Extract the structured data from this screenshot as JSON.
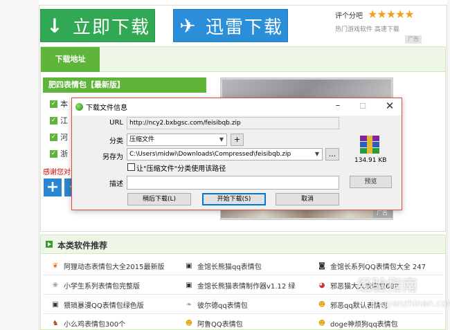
{
  "header": {
    "download_now": "立即下载",
    "xunlei_download": "迅雷下载",
    "rate_label": "评个分吧",
    "stars": "★★★★★",
    "sub_links": "热门游戏软件  高速下载",
    "ad": "广告"
  },
  "download_panel": {
    "tab": "下载地址",
    "package_title": "肥四表情包【最新版】",
    "rows": [
      "本",
      "江",
      "河",
      "浙"
    ],
    "thanks": "感谢您对",
    "ad": "广告"
  },
  "dialog": {
    "title": "下载文件信息",
    "url_label": "URL",
    "url_value": "http://ncy2.bxbgsc.com/feisibqb.zip",
    "category_label": "分类",
    "category_value": "压缩文件",
    "add_button": "+",
    "saveas_label": "另存为",
    "saveas_value": "C:\\Users\\midwi\\Downloads\\Compressed\\feisibqb.zip",
    "browse_button": "...",
    "checkbox_label": "让\"压缩文件\"分类使用该路径",
    "desc_label": "描述",
    "file_size": "134.91  KB",
    "preview_button": "预览",
    "later_button": "稍后下载(L)",
    "start_button": "开始下载(S)",
    "cancel_button": "取消"
  },
  "recommend": {
    "title": "本类软件推荐",
    "items": [
      "阿狸动态表情包大全2015最新版",
      "金馆长熊猫qq表情包",
      "金馆长系列QQ表情包大全 247",
      "小学生系列表情包完整版",
      "金馆长熊猫表情制作器v1.12 绿",
      "邪恶猫大人表情包68P",
      "猥琐暴漫QQ表情包绿色版",
      "彼尔德qq表情包",
      "邪恶qq默认表情包",
      "小么鸡表情包300个",
      "阿鲁QQ表情包",
      "doge神烦狗qq表情包"
    ]
  },
  "watermark": {
    "line1": "经验指南",
    "line2": "jingyanzhinan.com"
  },
  "colors": {
    "green": "#31a853",
    "blue": "#2b8ed8",
    "dialog_border": "#e04c3a"
  }
}
